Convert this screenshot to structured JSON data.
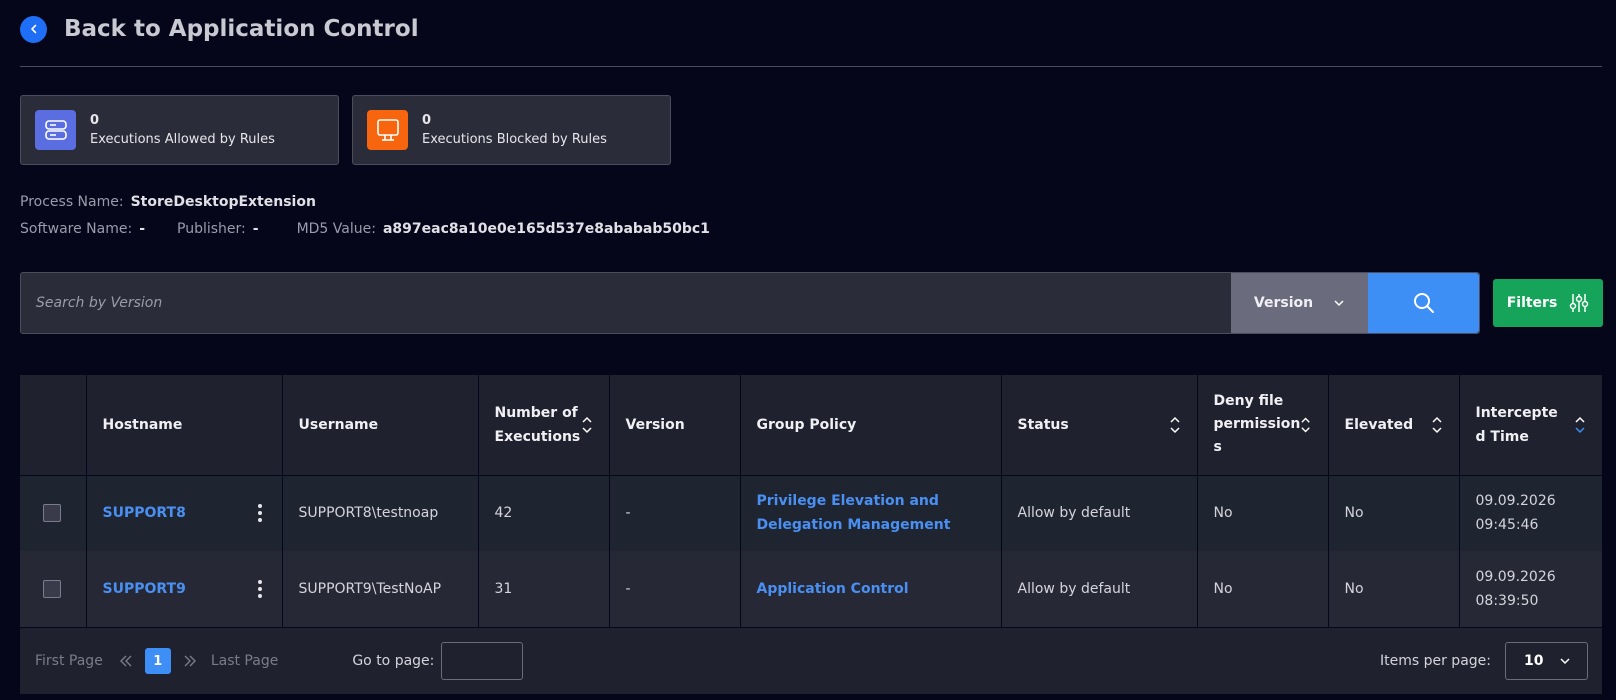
{
  "header": {
    "back_label": "Back to Application Control"
  },
  "stats": [
    {
      "count": "0",
      "label": "Executions Allowed by Rules",
      "icon": "server-icon",
      "color": "#5b6ee1"
    },
    {
      "count": "0",
      "label": "Executions Blocked by Rules",
      "icon": "monitor-icon",
      "color": "#f7650f"
    }
  ],
  "meta": {
    "process_key": "Process Name:",
    "process_val": "StoreDesktopExtension",
    "software_key": "Software Name:",
    "software_val": "-",
    "publisher_key": "Publisher:",
    "publisher_val": "-",
    "md5_key": "MD5 Value:",
    "md5_val": "a897eac8a10e0e165d537e8ababab50bc1"
  },
  "search": {
    "placeholder": "Search by Version",
    "field_label": "Version",
    "filters_label": "Filters"
  },
  "table": {
    "headers": {
      "hostname": "Hostname",
      "username": "Username",
      "executions_1": "Number of",
      "executions_2": "Executions",
      "version": "Version",
      "group_policy": "Group Policy",
      "status": "Status",
      "deny_1": "Deny file",
      "deny_2": "permission",
      "deny_3": "s",
      "elevated": "Elevated",
      "time_1": "Intercepte",
      "time_2": "d Time"
    },
    "rows": [
      {
        "hostname": "SUPPORT8",
        "username": "SUPPORT8\\testnoap",
        "executions": "42",
        "version": "-",
        "gp_1": "Privilege Elevation and",
        "gp_2": "Delegation Management",
        "status": "Allow by default",
        "deny": "No",
        "elevated": "No",
        "date": "09.09.2026",
        "time": "09:45:46"
      },
      {
        "hostname": "SUPPORT9",
        "username": "SUPPORT9\\TestNoAP",
        "executions": "31",
        "version": "-",
        "gp_1": "Application Control",
        "gp_2": "",
        "status": "Allow by default",
        "deny": "No",
        "elevated": "No",
        "date": "09.09.2026",
        "time": "08:39:50"
      }
    ]
  },
  "pagination": {
    "first": "First Page",
    "current": "1",
    "last": "Last Page",
    "goto_label": "Go to page:",
    "items_label": "Items per page:",
    "items_value": "10"
  },
  "colors": {
    "accent": "#3d8ef5",
    "success": "#15a45a",
    "background": "#05061a"
  }
}
